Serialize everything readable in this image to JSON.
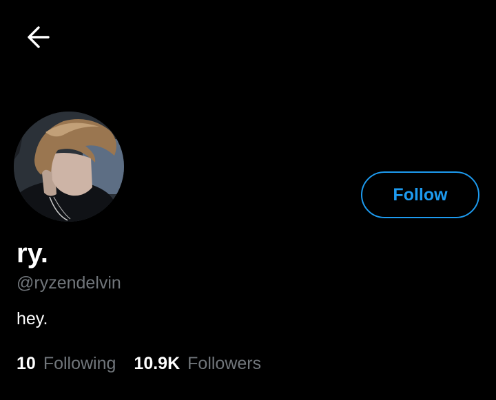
{
  "nav": {
    "back_icon": "arrow-left-icon"
  },
  "profile": {
    "display_name": "ry.",
    "handle": "@ryzendelvin",
    "bio": "hey.",
    "avatar": "profile-photo"
  },
  "actions": {
    "follow_label": "Follow"
  },
  "stats": {
    "following_count": "10",
    "following_label": "Following",
    "followers_count": "10.9K",
    "followers_label": "Followers"
  },
  "colors": {
    "background": "#000000",
    "accent": "#1d9bf0",
    "secondary_text": "#71767b",
    "primary_text": "#ffffff"
  }
}
